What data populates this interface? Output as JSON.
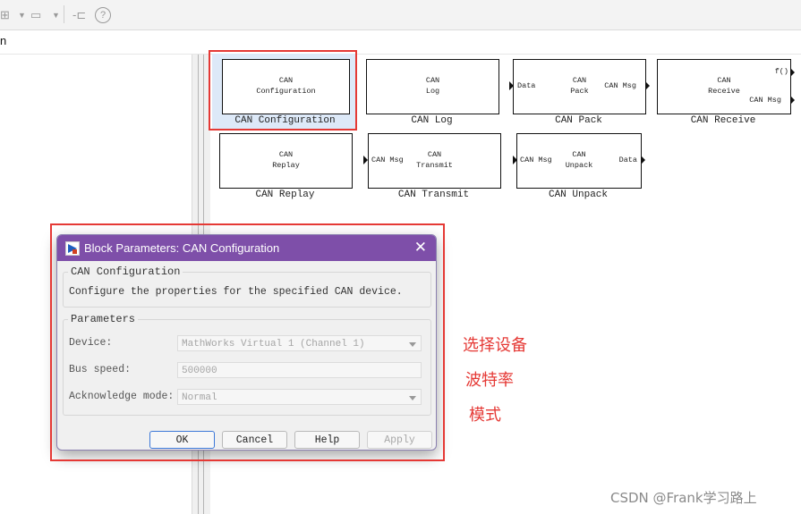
{
  "toolbar": {
    "menu_fragment": "n"
  },
  "blocks": [
    {
      "id": "config",
      "lines": [
        "CAN",
        "Configuration"
      ],
      "name": "CAN Configuration",
      "in_port": "",
      "out_port": ""
    },
    {
      "id": "log",
      "lines": [
        "CAN",
        "Log"
      ],
      "name": "CAN Log",
      "in_port": "",
      "out_port": ""
    },
    {
      "id": "pack",
      "lines": [
        "CAN",
        "Pack"
      ],
      "name": "CAN Pack",
      "in_port": "Data",
      "out_port": "CAN Msg"
    },
    {
      "id": "receive",
      "lines": [
        "CAN",
        "Receive"
      ],
      "name": "CAN Receive",
      "in_port": "",
      "out_port": "f()",
      "out_port2": "CAN Msg"
    },
    {
      "id": "replay",
      "lines": [
        "CAN",
        "Replay"
      ],
      "name": "CAN Replay",
      "in_port": "",
      "out_port": ""
    },
    {
      "id": "transmit",
      "lines": [
        "CAN",
        "Transmit"
      ],
      "name": "CAN Transmit",
      "in_port": "CAN Msg",
      "out_port": ""
    },
    {
      "id": "unpack",
      "lines": [
        "CAN",
        "Unpack"
      ],
      "name": "CAN Unpack",
      "in_port": "CAN Msg",
      "out_port": "Data"
    }
  ],
  "dialog": {
    "title": "Block Parameters: CAN Configuration",
    "section_title": "CAN Configuration",
    "description": "Configure the properties for the specified CAN device.",
    "params_title": "Parameters",
    "device_label": "Device:",
    "device_value": "MathWorks Virtual 1 (Channel 1)",
    "bus_speed_label": "Bus speed:",
    "bus_speed_value": "500000",
    "ack_mode_label": "Acknowledge mode:",
    "ack_mode_value": "Normal",
    "ok": "OK",
    "cancel": "Cancel",
    "help": "Help",
    "apply": "Apply"
  },
  "annotations": {
    "device_note": "选择设备",
    "speed_note": "波特率",
    "mode_note": "模式"
  },
  "watermark": "CSDN @Frank学习路上",
  "colors": {
    "highlight_red": "#e53935",
    "titlebar_purple": "#7e4fa9",
    "selection_blue": "#dde9f8"
  }
}
